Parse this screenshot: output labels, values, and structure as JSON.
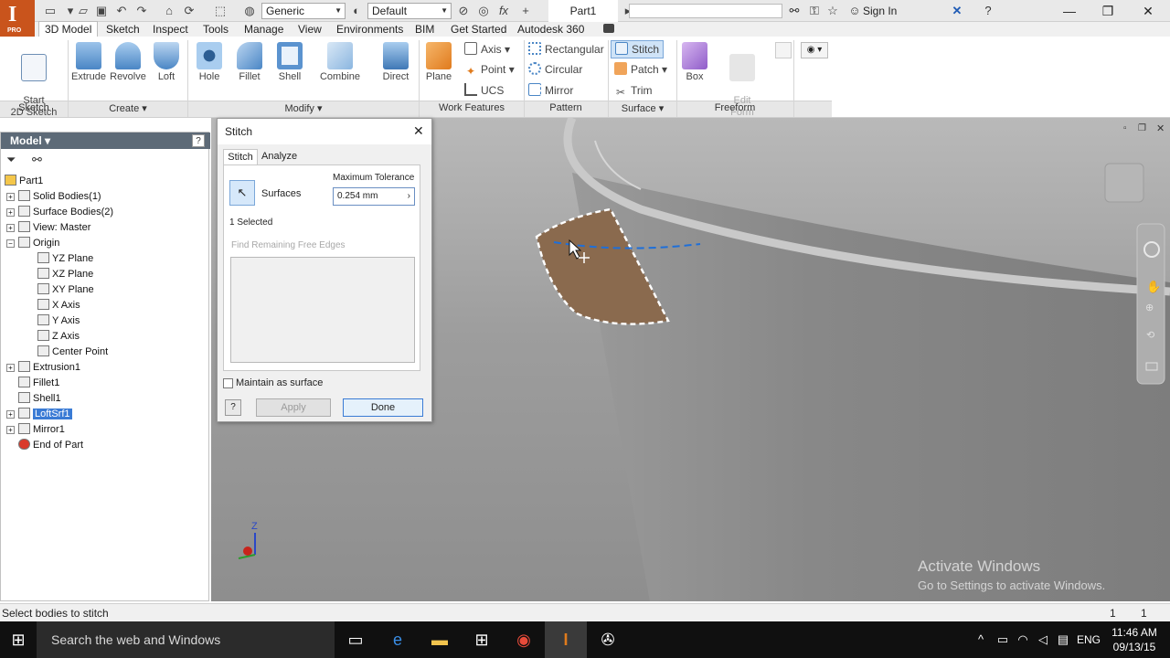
{
  "app": {
    "logo": "I",
    "edition": "PRO",
    "document_title": "Part1",
    "sign_in": "Sign In"
  },
  "qat": {
    "appearance_select": "Generic",
    "material_select": "Default"
  },
  "tabs": [
    "3D Model",
    "Sketch",
    "Inspect",
    "Tools",
    "Manage",
    "View",
    "Environments",
    "BIM",
    "Get Started",
    "Autodesk 360"
  ],
  "ribbon": {
    "sketch": {
      "start_2d_sketch": "Start\n2D Sketch",
      "panel": "Sketch"
    },
    "create": {
      "extrude": "Extrude",
      "revolve": "Revolve",
      "loft": "Loft",
      "panel": "Create"
    },
    "modify": {
      "hole": "Hole",
      "fillet": "Fillet",
      "shell": "Shell",
      "combine": "Combine",
      "direct": "Direct",
      "panel": "Modify"
    },
    "work_features": {
      "plane": "Plane",
      "axis": "Axis",
      "point": "Point",
      "ucs": "UCS",
      "panel": "Work Features"
    },
    "pattern": {
      "rectangular": "Rectangular",
      "circular": "Circular",
      "mirror": "Mirror",
      "panel": "Pattern"
    },
    "surface": {
      "stitch": "Stitch",
      "patch": "Patch",
      "trim": "Trim",
      "panel": "Surface"
    },
    "freeform": {
      "box": "Box",
      "edit_form": "Edit\nForm",
      "panel": "Freeform"
    }
  },
  "browser": {
    "title": "Model",
    "nodes": [
      {
        "label": "Part1",
        "level": 0,
        "expander": ""
      },
      {
        "label": "Solid Bodies(1)",
        "level": 1,
        "expander": "+"
      },
      {
        "label": "Surface Bodies(2)",
        "level": 1,
        "expander": "+"
      },
      {
        "label": "View: Master",
        "level": 1,
        "expander": "+"
      },
      {
        "label": "Origin",
        "level": 1,
        "expander": "−"
      },
      {
        "label": "YZ Plane",
        "level": 2,
        "expander": ""
      },
      {
        "label": "XZ Plane",
        "level": 2,
        "expander": ""
      },
      {
        "label": "XY Plane",
        "level": 2,
        "expander": ""
      },
      {
        "label": "X Axis",
        "level": 2,
        "expander": ""
      },
      {
        "label": "Y Axis",
        "level": 2,
        "expander": ""
      },
      {
        "label": "Z Axis",
        "level": 2,
        "expander": ""
      },
      {
        "label": "Center Point",
        "level": 2,
        "expander": ""
      },
      {
        "label": "Extrusion1",
        "level": 1,
        "expander": "+"
      },
      {
        "label": "Fillet1",
        "level": 1,
        "expander": ""
      },
      {
        "label": "Shell1",
        "level": 1,
        "expander": ""
      },
      {
        "label": "LoftSrf1",
        "level": 1,
        "expander": "+",
        "selected": true
      },
      {
        "label": "Mirror1",
        "level": 1,
        "expander": "+"
      },
      {
        "label": "End of Part",
        "level": 1,
        "expander": ""
      }
    ]
  },
  "dialog": {
    "title": "Stitch",
    "tabs": [
      "Stitch",
      "Analyze"
    ],
    "max_tolerance_label": "Maximum Tolerance",
    "tolerance_value": "0.254 mm",
    "surfaces_label": "Surfaces",
    "selected_count": "1 Selected",
    "find_edges": "Find Remaining Free Edges",
    "maintain_surface": "Maintain as surface",
    "apply": "Apply",
    "done": "Done"
  },
  "viewport": {
    "watermark_title": "Activate Windows",
    "watermark_sub": "Go to Settings to activate Windows.",
    "axis_z": "Z"
  },
  "status": {
    "message": "Select bodies to stitch",
    "count_a": "1",
    "count_b": "1"
  },
  "taskbar": {
    "search_placeholder": "Search the web and Windows",
    "language": "ENG",
    "time": "11:46 AM",
    "date": "09/13/15"
  },
  "colors": {
    "accent": "#c9541c",
    "browser_header": "#5d6a77",
    "selection_blue": "#1e6fd9",
    "taskbar": "#101010"
  }
}
